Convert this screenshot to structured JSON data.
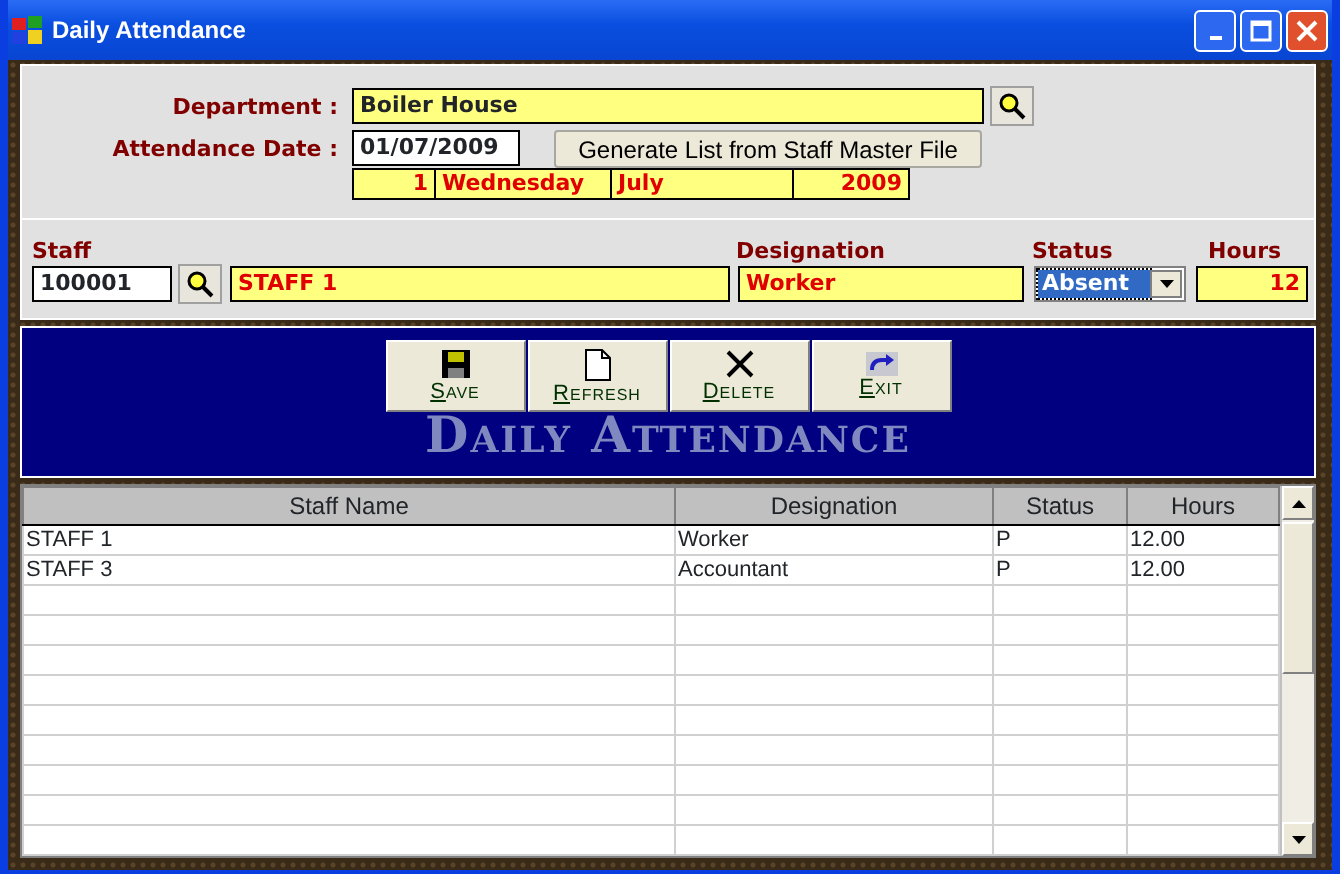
{
  "window": {
    "title": "Daily Attendance"
  },
  "header": {
    "department_label": "Department :",
    "department": "Boiler House",
    "date_label": "Attendance Date :",
    "date": "01/07/2009",
    "generate_button": "Generate List from Staff Master File",
    "date_parts": [
      "1",
      "Wednesday",
      "July",
      "2009"
    ]
  },
  "entry": {
    "staff_label": "Staff",
    "staff_code": "100001",
    "staff_name": "STAFF 1",
    "designation_label": "Designation",
    "designation": "Worker",
    "status_label": "Status",
    "status": "Absent",
    "status_highlighted": true,
    "hours_label": "Hours",
    "hours": "12"
  },
  "toolbar": {
    "buttons": [
      {
        "kind": "save",
        "label": "Save"
      },
      {
        "kind": "refresh",
        "label": "Refresh"
      },
      {
        "kind": "delete",
        "label": "Delete"
      },
      {
        "kind": "exit",
        "label": "Exit"
      }
    ],
    "title": "Daily Attendance"
  },
  "table": {
    "columns": [
      "Staff Name",
      "Designation",
      "Status",
      "Hours"
    ],
    "rows": [
      [
        "STAFF 1",
        "Worker",
        "P",
        "12.00"
      ],
      [
        "STAFF 3",
        "Accountant",
        "P",
        "12.00"
      ]
    ]
  }
}
